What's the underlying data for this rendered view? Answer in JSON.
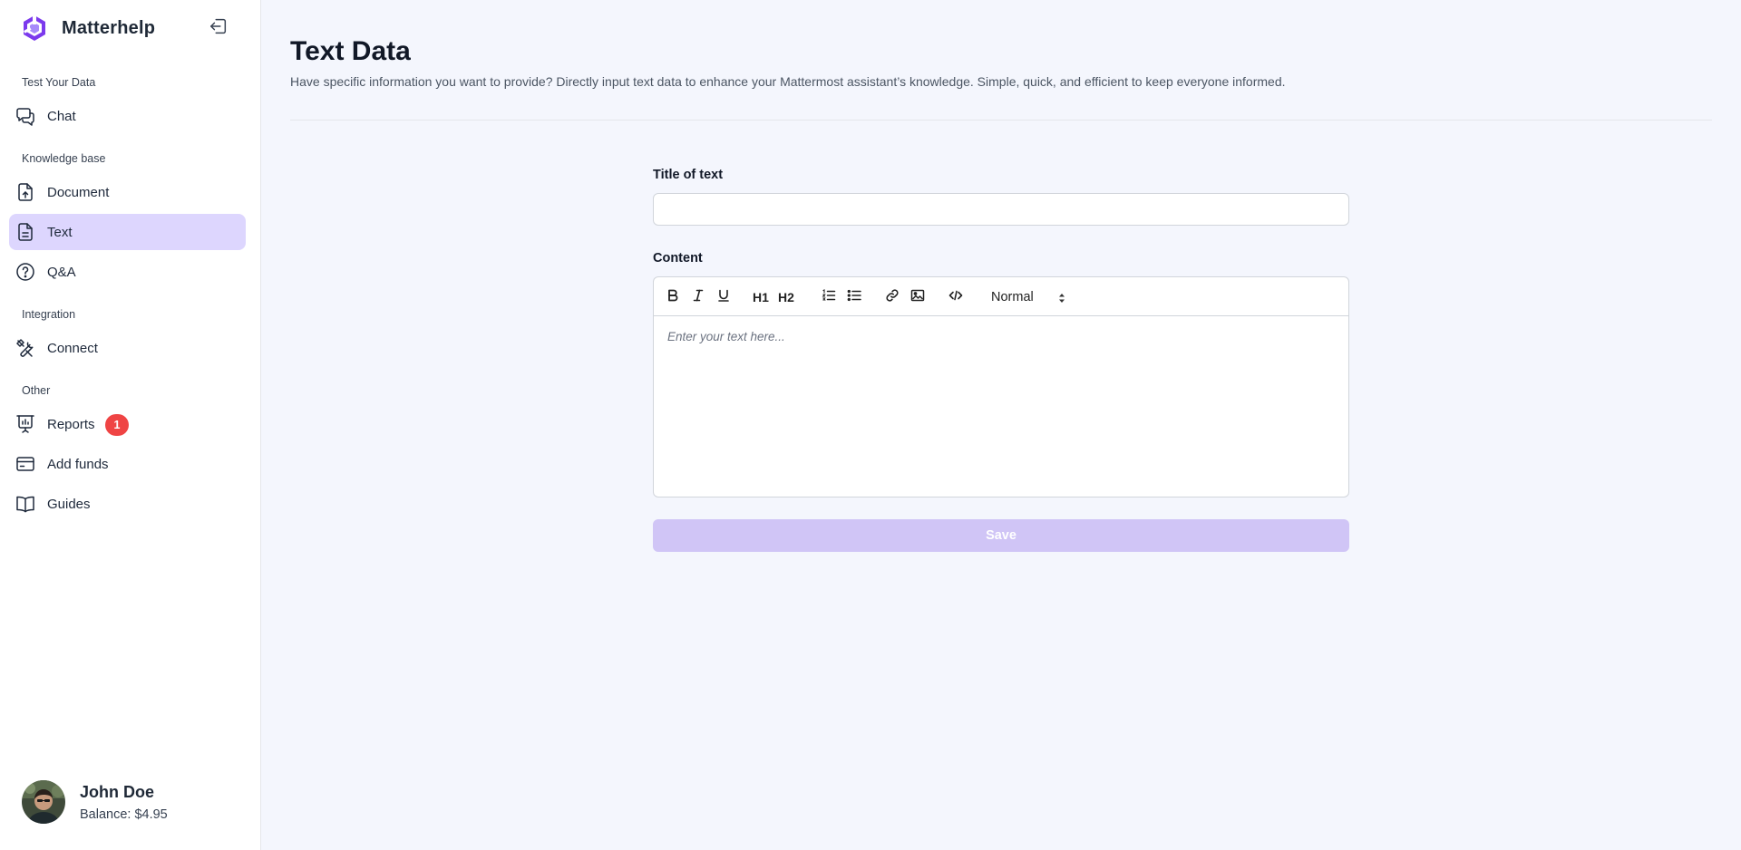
{
  "brand": {
    "name": "Matterhelp"
  },
  "sidebar": {
    "sections": [
      {
        "label": "Test Your Data"
      },
      {
        "label": "Knowledge base"
      },
      {
        "label": "Integration"
      },
      {
        "label": "Other"
      }
    ],
    "items": [
      {
        "label": "Chat",
        "icon": "chat-icon"
      },
      {
        "label": "Document",
        "icon": "document-upload-icon"
      },
      {
        "label": "Text",
        "icon": "text-file-icon",
        "active": true
      },
      {
        "label": "Q&A",
        "icon": "question-circle-icon"
      },
      {
        "label": "Connect",
        "icon": "tools-icon"
      },
      {
        "label": "Reports",
        "icon": "presentation-chart-icon",
        "badge": "1"
      },
      {
        "label": "Add funds",
        "icon": "credit-card-icon"
      },
      {
        "label": "Guides",
        "icon": "book-open-icon"
      }
    ]
  },
  "user": {
    "name": "John Doe",
    "balance": "Balance: $4.95"
  },
  "main": {
    "title": "Text Data",
    "subtitle": "Have specific information you want to provide? Directly input text data to enhance your Mattermost assistant’s knowledge. Simple, quick, and efficient to keep everyone informed.",
    "title_field": {
      "label": "Title of text",
      "value": "",
      "placeholder": ""
    },
    "content_field": {
      "label": "Content",
      "placeholder": "Enter your text here..."
    },
    "toolbar": {
      "h1": "H1",
      "h2": "H2",
      "format_selected": "Normal"
    },
    "save_label": "Save"
  },
  "colors": {
    "accent": "#7c3aed",
    "active_nav_bg": "#ddd6fe",
    "save_button_bg": "#d0c5f6",
    "badge_bg": "#ef4444",
    "page_bg": "#f4f6fd"
  }
}
